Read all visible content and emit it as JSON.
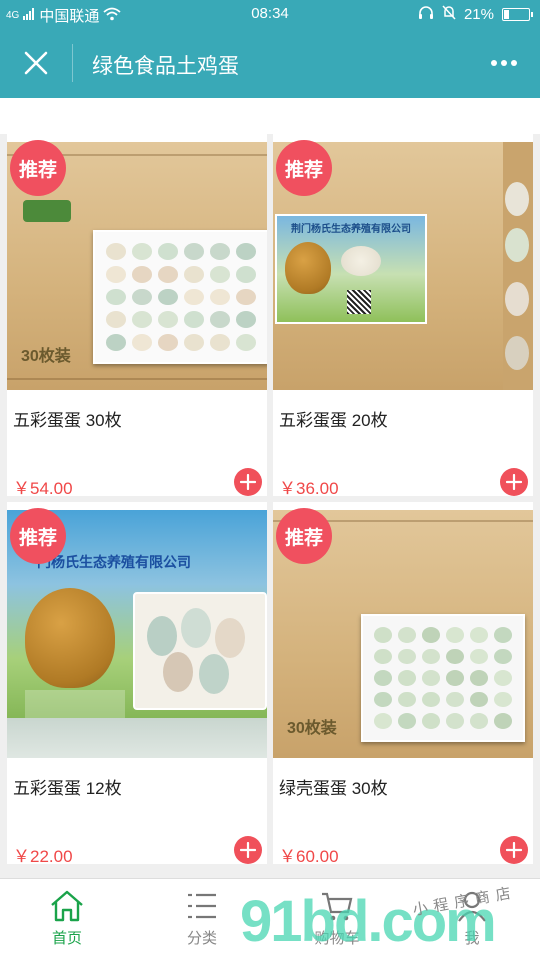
{
  "status_bar": {
    "signal": "4G",
    "carrier": "中国联通",
    "time": "08:34",
    "battery": "21%",
    "battery_level": 0.21
  },
  "header": {
    "title": "绿色食品土鸡蛋"
  },
  "products": [
    {
      "badge": "推荐",
      "name": "五彩蛋蛋 30枚",
      "price": "￥54.00",
      "box_text": "30枚装"
    },
    {
      "badge": "推荐",
      "name": "五彩蛋蛋 20枚",
      "price": "￥36.00",
      "sticker_title": "荆门杨氏生态养殖有限公司"
    },
    {
      "badge": "推荐",
      "name": "五彩蛋蛋 12枚",
      "price": "￥22.00",
      "sticker_title": "门杨氏生态养殖有限公司"
    },
    {
      "badge": "推荐",
      "name": "绿壳蛋蛋 30枚",
      "price": "￥60.00",
      "box_text": "30枚装"
    }
  ],
  "bottom_nav": [
    {
      "label": "首页",
      "icon": "home-icon",
      "active": true
    },
    {
      "label": "分类",
      "icon": "list-icon",
      "active": false
    },
    {
      "label": "购物车",
      "icon": "cart-icon",
      "active": false
    },
    {
      "label": "我",
      "icon": "user-icon",
      "active": false
    }
  ],
  "watermark": {
    "logo": "91bd.com",
    "tagline": "小程序商店"
  },
  "colors": {
    "header": "#39a9b7",
    "badge": "#f0505f",
    "price": "#f04848",
    "nav_active": "#1aa34a"
  }
}
